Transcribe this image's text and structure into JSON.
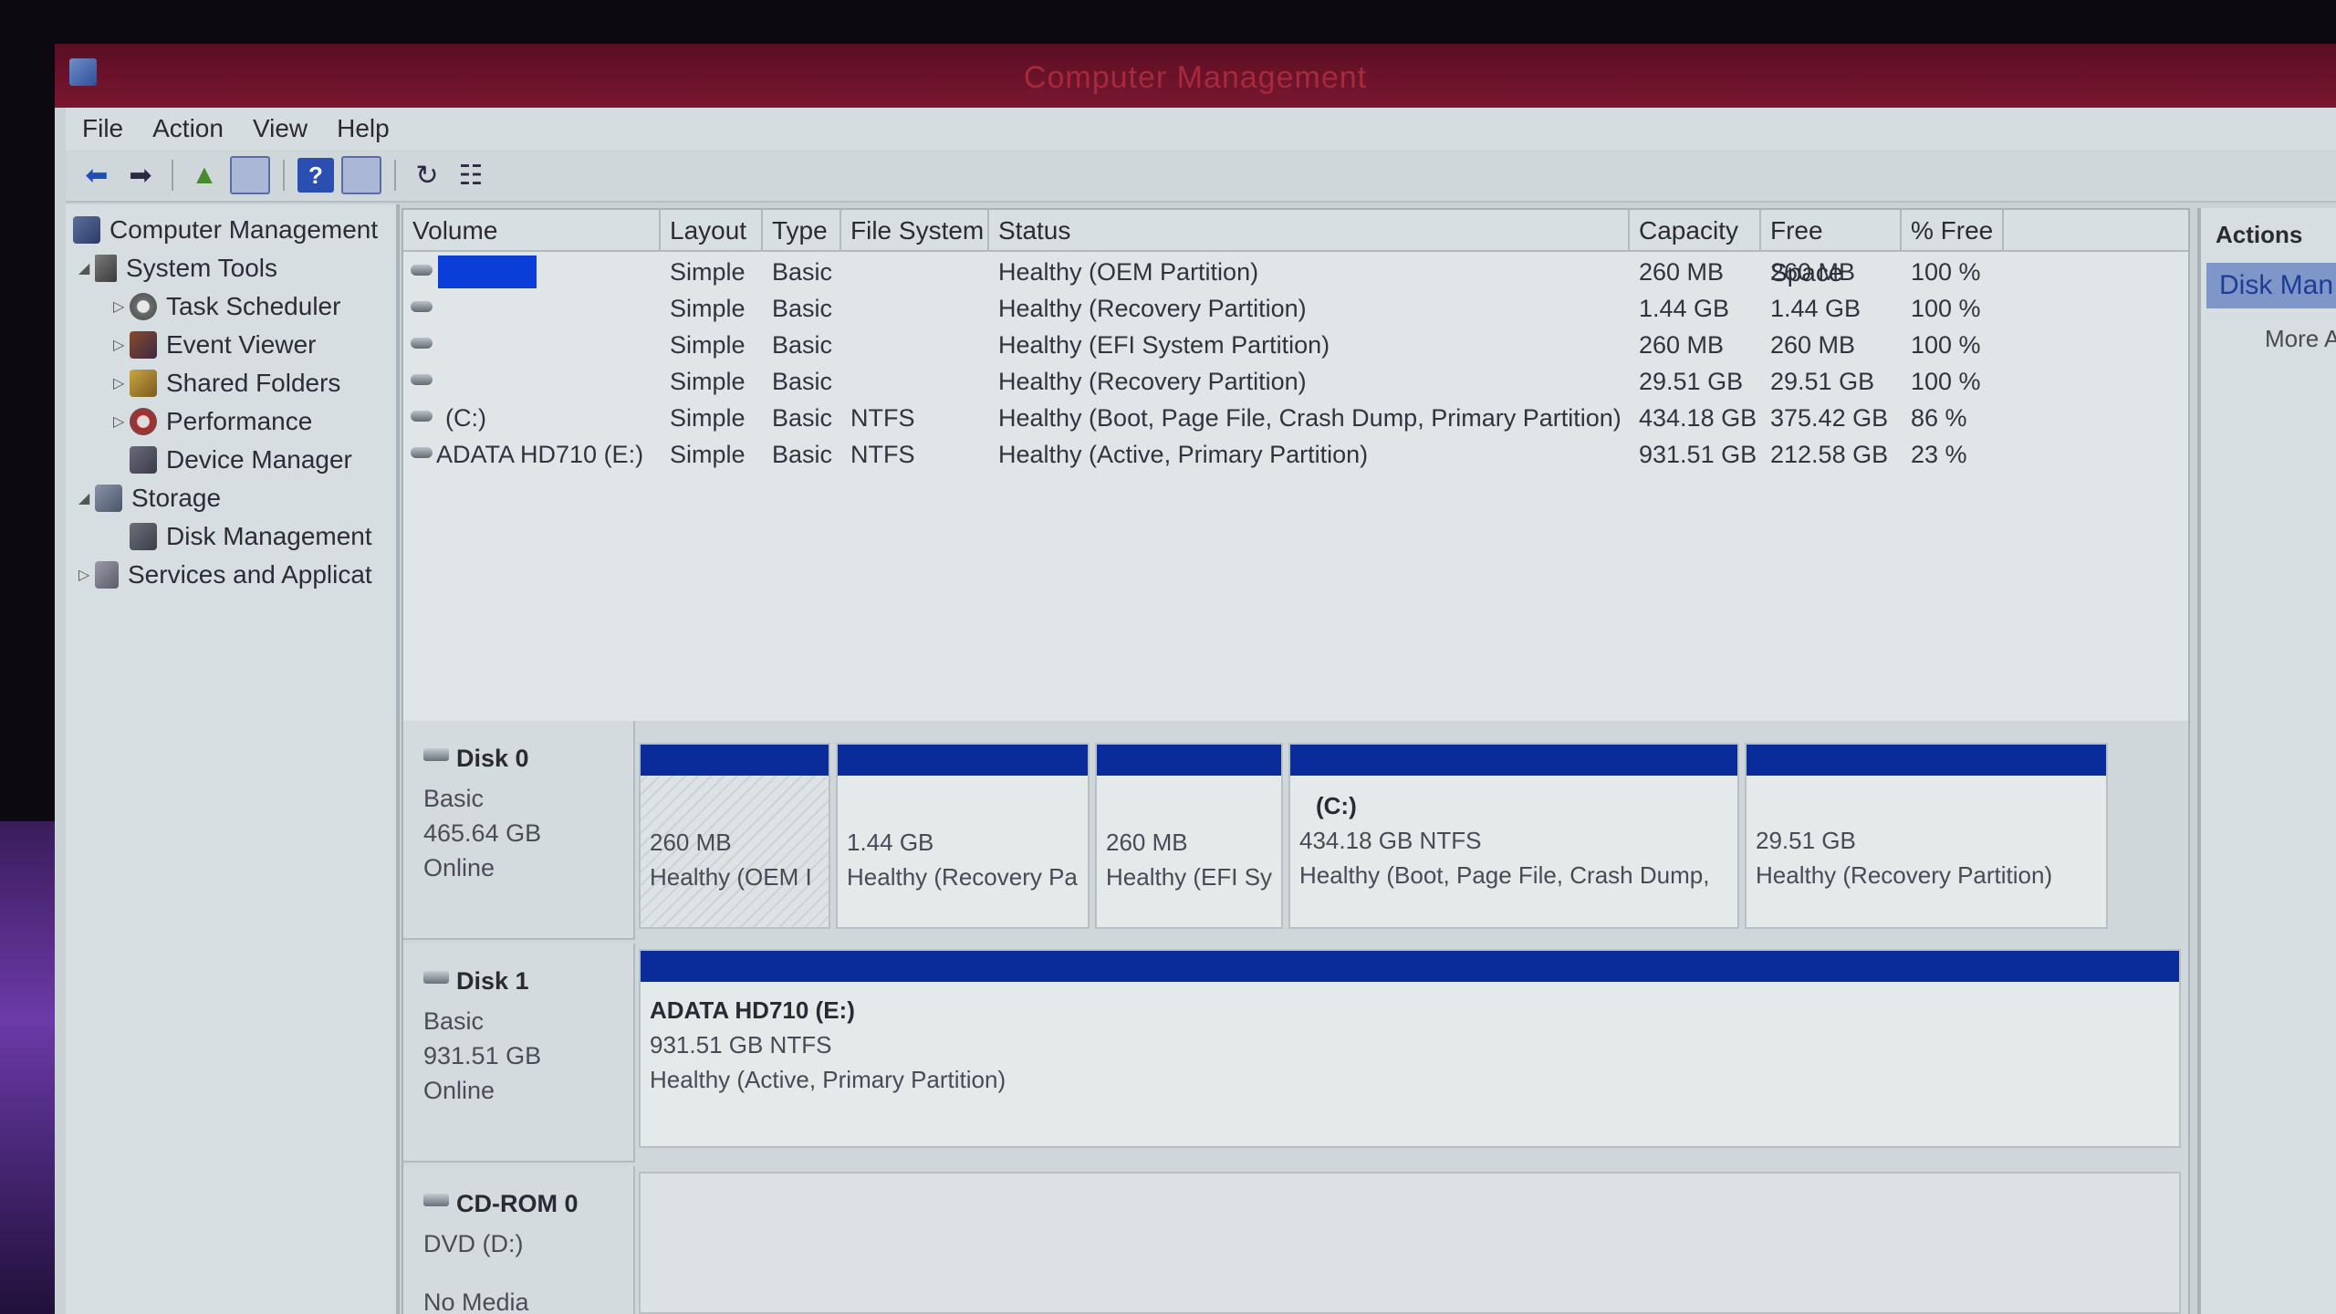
{
  "window": {
    "title": "Computer Management"
  },
  "menu": [
    "File",
    "Action",
    "View",
    "Help"
  ],
  "toolbar": {
    "icons": [
      "back-arrow-icon",
      "forward-arrow-icon",
      "up-folder-icon",
      "show-hide-tree-icon",
      "help-icon",
      "view-panel-icon",
      "refresh-icon",
      "properties-icon"
    ]
  },
  "tree": {
    "items": [
      {
        "label": "Computer Management",
        "icon": "computer-management-icon"
      },
      {
        "label": "System Tools",
        "icon": "tools-icon"
      },
      {
        "label": "Task Scheduler",
        "icon": "clock-icon"
      },
      {
        "label": "Event Viewer",
        "icon": "event-viewer-icon"
      },
      {
        "label": "Shared Folders",
        "icon": "shared-folders-icon"
      },
      {
        "label": "Performance",
        "icon": "performance-icon"
      },
      {
        "label": "Device Manager",
        "icon": "device-manager-icon"
      },
      {
        "label": "Storage",
        "icon": "storage-icon"
      },
      {
        "label": "Disk Management",
        "icon": "disk-management-icon"
      },
      {
        "label": "Services and Applicat",
        "icon": "services-icon"
      }
    ]
  },
  "volumes": {
    "columns": [
      "Volume",
      "Layout",
      "Type",
      "File System",
      "Status",
      "Capacity",
      "Free Space",
      "% Free"
    ],
    "rows": [
      {
        "volume": "",
        "layout": "Simple",
        "type": "Basic",
        "fs": "",
        "status": "Healthy (OEM Partition)",
        "capacity": "260 MB",
        "free": "260 MB",
        "pct": "100 %"
      },
      {
        "volume": "",
        "layout": "Simple",
        "type": "Basic",
        "fs": "",
        "status": "Healthy (Recovery Partition)",
        "capacity": "1.44 GB",
        "free": "1.44 GB",
        "pct": "100 %"
      },
      {
        "volume": "",
        "layout": "Simple",
        "type": "Basic",
        "fs": "",
        "status": "Healthy (EFI System Partition)",
        "capacity": "260 MB",
        "free": "260 MB",
        "pct": "100 %"
      },
      {
        "volume": "",
        "layout": "Simple",
        "type": "Basic",
        "fs": "",
        "status": "Healthy (Recovery Partition)",
        "capacity": "29.51 GB",
        "free": "29.51 GB",
        "pct": "100 %"
      },
      {
        "volume": "(C:)",
        "layout": "Simple",
        "type": "Basic",
        "fs": "NTFS",
        "status": "Healthy (Boot, Page File, Crash Dump, Primary Partition)",
        "capacity": "434.18 GB",
        "free": "375.42 GB",
        "pct": "86 %"
      },
      {
        "volume": "ADATA HD710 (E:)",
        "layout": "Simple",
        "type": "Basic",
        "fs": "NTFS",
        "status": "Healthy (Active, Primary Partition)",
        "capacity": "931.51 GB",
        "free": "212.58 GB",
        "pct": "23 %"
      }
    ]
  },
  "disks": [
    {
      "name": "Disk 0",
      "type": "Basic",
      "size": "465.64 GB",
      "state": "Online",
      "partitions": [
        {
          "title": "",
          "size": "260 MB",
          "status": "Healthy (OEM I"
        },
        {
          "title": "",
          "size": "1.44 GB",
          "status": "Healthy (Recovery Pa"
        },
        {
          "title": "",
          "size": "260 MB",
          "status": "Healthy (EFI Sy"
        },
        {
          "title": "(C:)",
          "size": "434.18 GB NTFS",
          "status": "Healthy (Boot, Page File, Crash Dump,"
        },
        {
          "title": "",
          "size": "29.51 GB",
          "status": "Healthy (Recovery Partition)"
        }
      ]
    },
    {
      "name": "Disk 1",
      "type": "Basic",
      "size": "931.51 GB",
      "state": "Online",
      "partitions": [
        {
          "title": "ADATA HD710  (E:)",
          "size": "931.51 GB NTFS",
          "status": "Healthy (Active, Primary Partition)"
        }
      ]
    },
    {
      "name": "CD-ROM 0",
      "type": "DVD (D:)",
      "size": "No Media",
      "state": "",
      "partitions": []
    }
  ],
  "actions": {
    "title": "Actions",
    "selected": "Disk Man",
    "more": "More A"
  }
}
